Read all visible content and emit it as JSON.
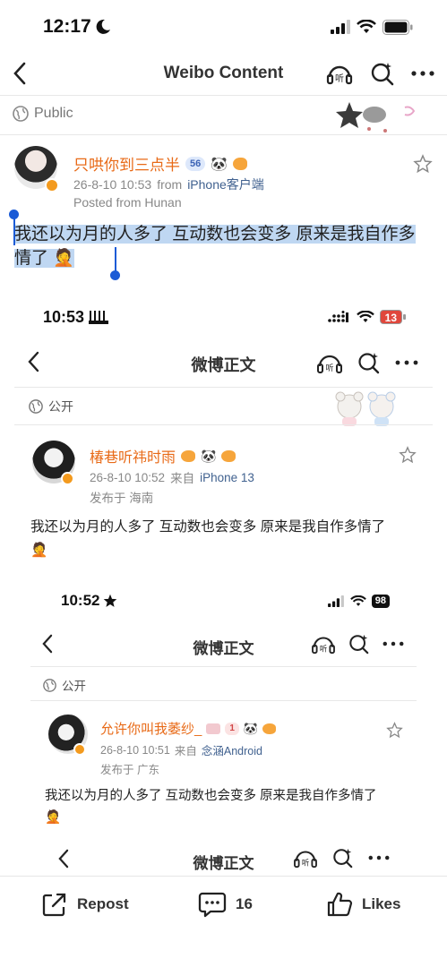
{
  "status_bar": {
    "time": "12:17"
  },
  "nav": {
    "title": "Weibo Content"
  },
  "visibility": {
    "label": "Public"
  },
  "post": {
    "username": "只哄你到三点半",
    "level_badge": "56",
    "timestamp": "26-8-10 10:53",
    "from_prefix": "from",
    "source": "iPhone客户端",
    "location": "Posted from Hunan",
    "text": "我还以为月的人多了 互动数也会变多 原来是我自作多情了"
  },
  "shot1": {
    "time": "10:53",
    "battery": "13",
    "nav_title": "微博正文",
    "visibility": "公开",
    "username": "椿巷听祎时雨",
    "timestamp": "26-8-10 10:52",
    "from_prefix": "来自",
    "source": "iPhone 13",
    "location": "发布于 海南",
    "text": "我还以为月的人多了 互动数也会变多 原来是我自作多情了"
  },
  "shot2": {
    "time": "10:52",
    "battery": "98",
    "nav_title": "微博正文",
    "visibility": "公开",
    "username": "允许你叫我萎纱_",
    "level_badge": "1",
    "timestamp": "26-8-10 10:51",
    "from_prefix": "来自",
    "source": "念涵Android",
    "location": "发布于 广东",
    "text": "我还以为月的人多了 互动数也会变多 原来是我自作多情了"
  },
  "shot3": {
    "nav_title": "微博正文"
  },
  "bottom_bar": {
    "repost": "Repost",
    "comments": "16",
    "likes": "Likes"
  },
  "colors": {
    "accent_orange": "#e86a17",
    "link_blue": "#40618f",
    "selection": "#bfd7f2",
    "battery_low": "#e0473c"
  }
}
